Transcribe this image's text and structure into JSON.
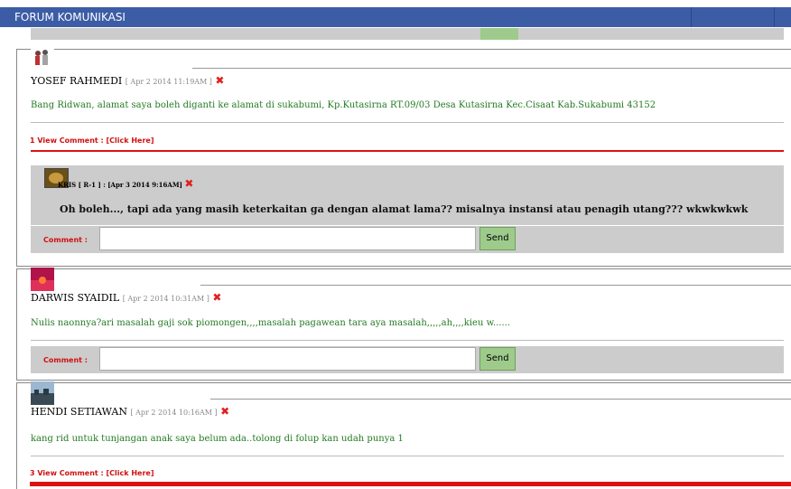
{
  "header": {
    "title": "FORUM KOMUNIKASI"
  },
  "posts": [
    {
      "author": "YOSEF RAHMEDI",
      "meta": "[ Apr 2 2014 11:19AM ]",
      "message": "Bang Ridwan, alamat saya boleh diganti ke alamat di sukabumi, Kp.Kutasirna RT.09/03 Desa Kutasirna Kec.Cisaat Kab.Sukabumi 43152",
      "view_comment": "1 View Comment : [Click Here]",
      "reply": {
        "header": "KRIS [ R-1 ] : [Apr 3 2014 9:16AM]",
        "text": "Oh boleh..., tapi ada yang masih keterkaitan ga dengan alamat lama?? misalnya instansi atau penagih utang??? wkwkwkwk"
      }
    },
    {
      "author": "DARWIS SYAIDIL",
      "meta": "[ Apr 2 2014 10:31AM ]",
      "message": "Nulis naonnya?ari masalah gaji sok piomongen,,,,masalah pagawean tara aya masalah,,,,,ah,,,,kieu w......"
    },
    {
      "author": "HENDI SETIAWAN",
      "meta": "[ Apr 2 2014 10:16AM ]",
      "message": "kang rid untuk tunjangan anak saya belum ada..tolong di folup kan udah punya 1",
      "view_comment": "3 View Comment : [Click Here]"
    }
  ],
  "comment_bar": {
    "label": "Comment :",
    "send": "Send"
  },
  "icons": {
    "delete": "✖"
  },
  "colors": {
    "header_bg": "#3c5ca5",
    "message": "#237a23",
    "accent_red": "#d01010",
    "send_bg": "#9ecb8c"
  }
}
